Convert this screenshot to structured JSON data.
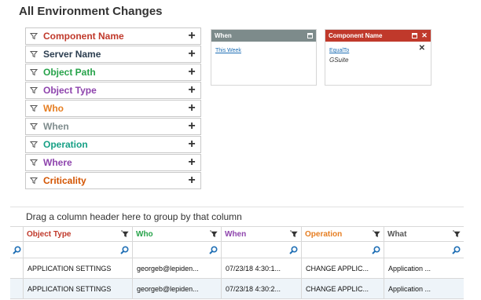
{
  "title": "All Environment Changes",
  "filters": [
    {
      "label": "Component Name",
      "color": "#c0392b",
      "add": "+"
    },
    {
      "label": "Server Name",
      "color": "#2c3e50",
      "add": "+"
    },
    {
      "label": "Object Path",
      "color": "#27a34a",
      "add": "+"
    },
    {
      "label": "Object Type",
      "color": "#8e44ad",
      "add": "+"
    },
    {
      "label": "Who",
      "color": "#e67e22",
      "add": "+"
    },
    {
      "label": "When",
      "color": "#7f8c8d",
      "add": "+"
    },
    {
      "label": "Operation",
      "color": "#16a085",
      "add": "+"
    },
    {
      "label": "Where",
      "color": "#8e44ad",
      "add": "+"
    },
    {
      "label": "Criticality",
      "color": "#d35400",
      "add": "+"
    }
  ],
  "cards": {
    "when": {
      "title": "When",
      "link": "This Week",
      "header_color": "#7d8b8b"
    },
    "component": {
      "title": "Component Name",
      "link": "EqualTo",
      "value": "GSuite",
      "header_color": "#c0392b",
      "close": "✕",
      "remove": "✕"
    }
  },
  "grid": {
    "group_hint": "Drag a column header here to group by that column",
    "columns": [
      {
        "label": "Object Type",
        "color": "#c0392b"
      },
      {
        "label": "Who",
        "color": "#27a34a"
      },
      {
        "label": "When",
        "color": "#8e44ad"
      },
      {
        "label": "Operation",
        "color": "#e67e22"
      },
      {
        "label": "What",
        "color": "#555555"
      }
    ],
    "rows": [
      [
        "APPLICATION SETTINGS",
        "georgeb@lepiden...",
        "07/23/18 4:30:1...",
        "CHANGE APPLIC...",
        "Application ..."
      ],
      [
        "APPLICATION SETTINGS",
        "georgeb@lepiden...",
        "07/23/18 4:30:2...",
        "CHANGE APPLIC...",
        "Application ..."
      ]
    ]
  },
  "icons": {
    "filter": "funnel-icon",
    "search": "magnifier-icon",
    "column_filter": "funnel-icon"
  }
}
